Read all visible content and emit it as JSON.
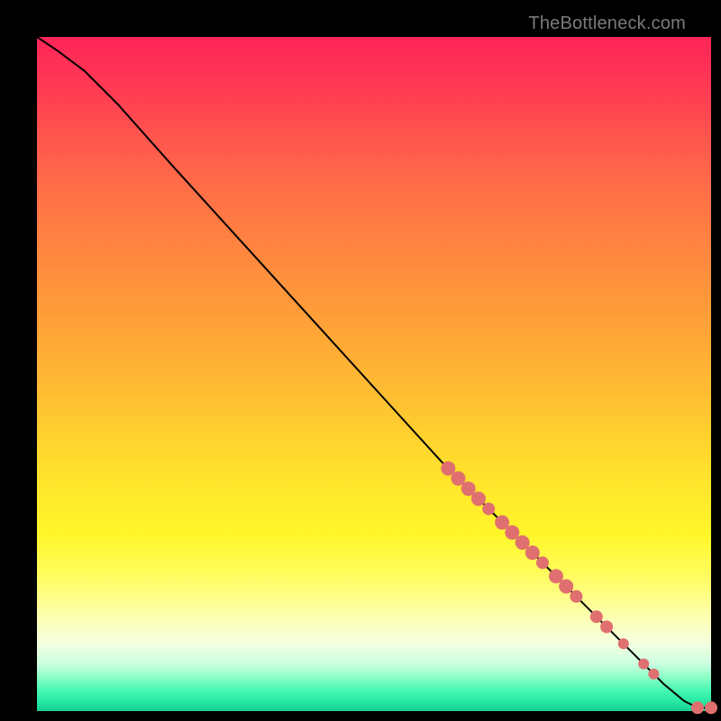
{
  "attribution": "TheBottleneck.com",
  "colors": {
    "point_fill": "#e07070",
    "line_stroke": "#000000"
  },
  "chart_data": {
    "type": "line",
    "title": "",
    "xlabel": "",
    "ylabel": "",
    "xlim": [
      0,
      100
    ],
    "ylim": [
      0,
      100
    ],
    "series": [
      {
        "name": "bottleneck-curve",
        "kind": "line",
        "x": [
          0,
          3,
          7,
          12,
          20,
          30,
          40,
          50,
          60,
          70,
          80,
          88,
          93,
          96,
          98,
          100
        ],
        "y": [
          100,
          98,
          95,
          90,
          81,
          70,
          59,
          48,
          37,
          27,
          17,
          9,
          4,
          1.5,
          0.5,
          0.5
        ]
      },
      {
        "name": "sample-points",
        "kind": "scatter",
        "points": [
          {
            "x": 61,
            "y": 36,
            "r": 8
          },
          {
            "x": 62.5,
            "y": 34.5,
            "r": 8
          },
          {
            "x": 64,
            "y": 33,
            "r": 8
          },
          {
            "x": 65.5,
            "y": 31.5,
            "r": 8
          },
          {
            "x": 67,
            "y": 30,
            "r": 7
          },
          {
            "x": 69,
            "y": 28,
            "r": 8
          },
          {
            "x": 70.5,
            "y": 26.5,
            "r": 8
          },
          {
            "x": 72,
            "y": 25,
            "r": 8
          },
          {
            "x": 73.5,
            "y": 23.5,
            "r": 8
          },
          {
            "x": 75,
            "y": 22,
            "r": 7
          },
          {
            "x": 77,
            "y": 20,
            "r": 8
          },
          {
            "x": 78.5,
            "y": 18.5,
            "r": 8
          },
          {
            "x": 80,
            "y": 17,
            "r": 7
          },
          {
            "x": 83,
            "y": 14,
            "r": 7
          },
          {
            "x": 84.5,
            "y": 12.5,
            "r": 7
          },
          {
            "x": 87,
            "y": 10,
            "r": 6
          },
          {
            "x": 90,
            "y": 7,
            "r": 6
          },
          {
            "x": 91.5,
            "y": 5.5,
            "r": 6
          },
          {
            "x": 98,
            "y": 0.5,
            "r": 7
          },
          {
            "x": 100,
            "y": 0.5,
            "r": 7
          }
        ]
      }
    ]
  }
}
